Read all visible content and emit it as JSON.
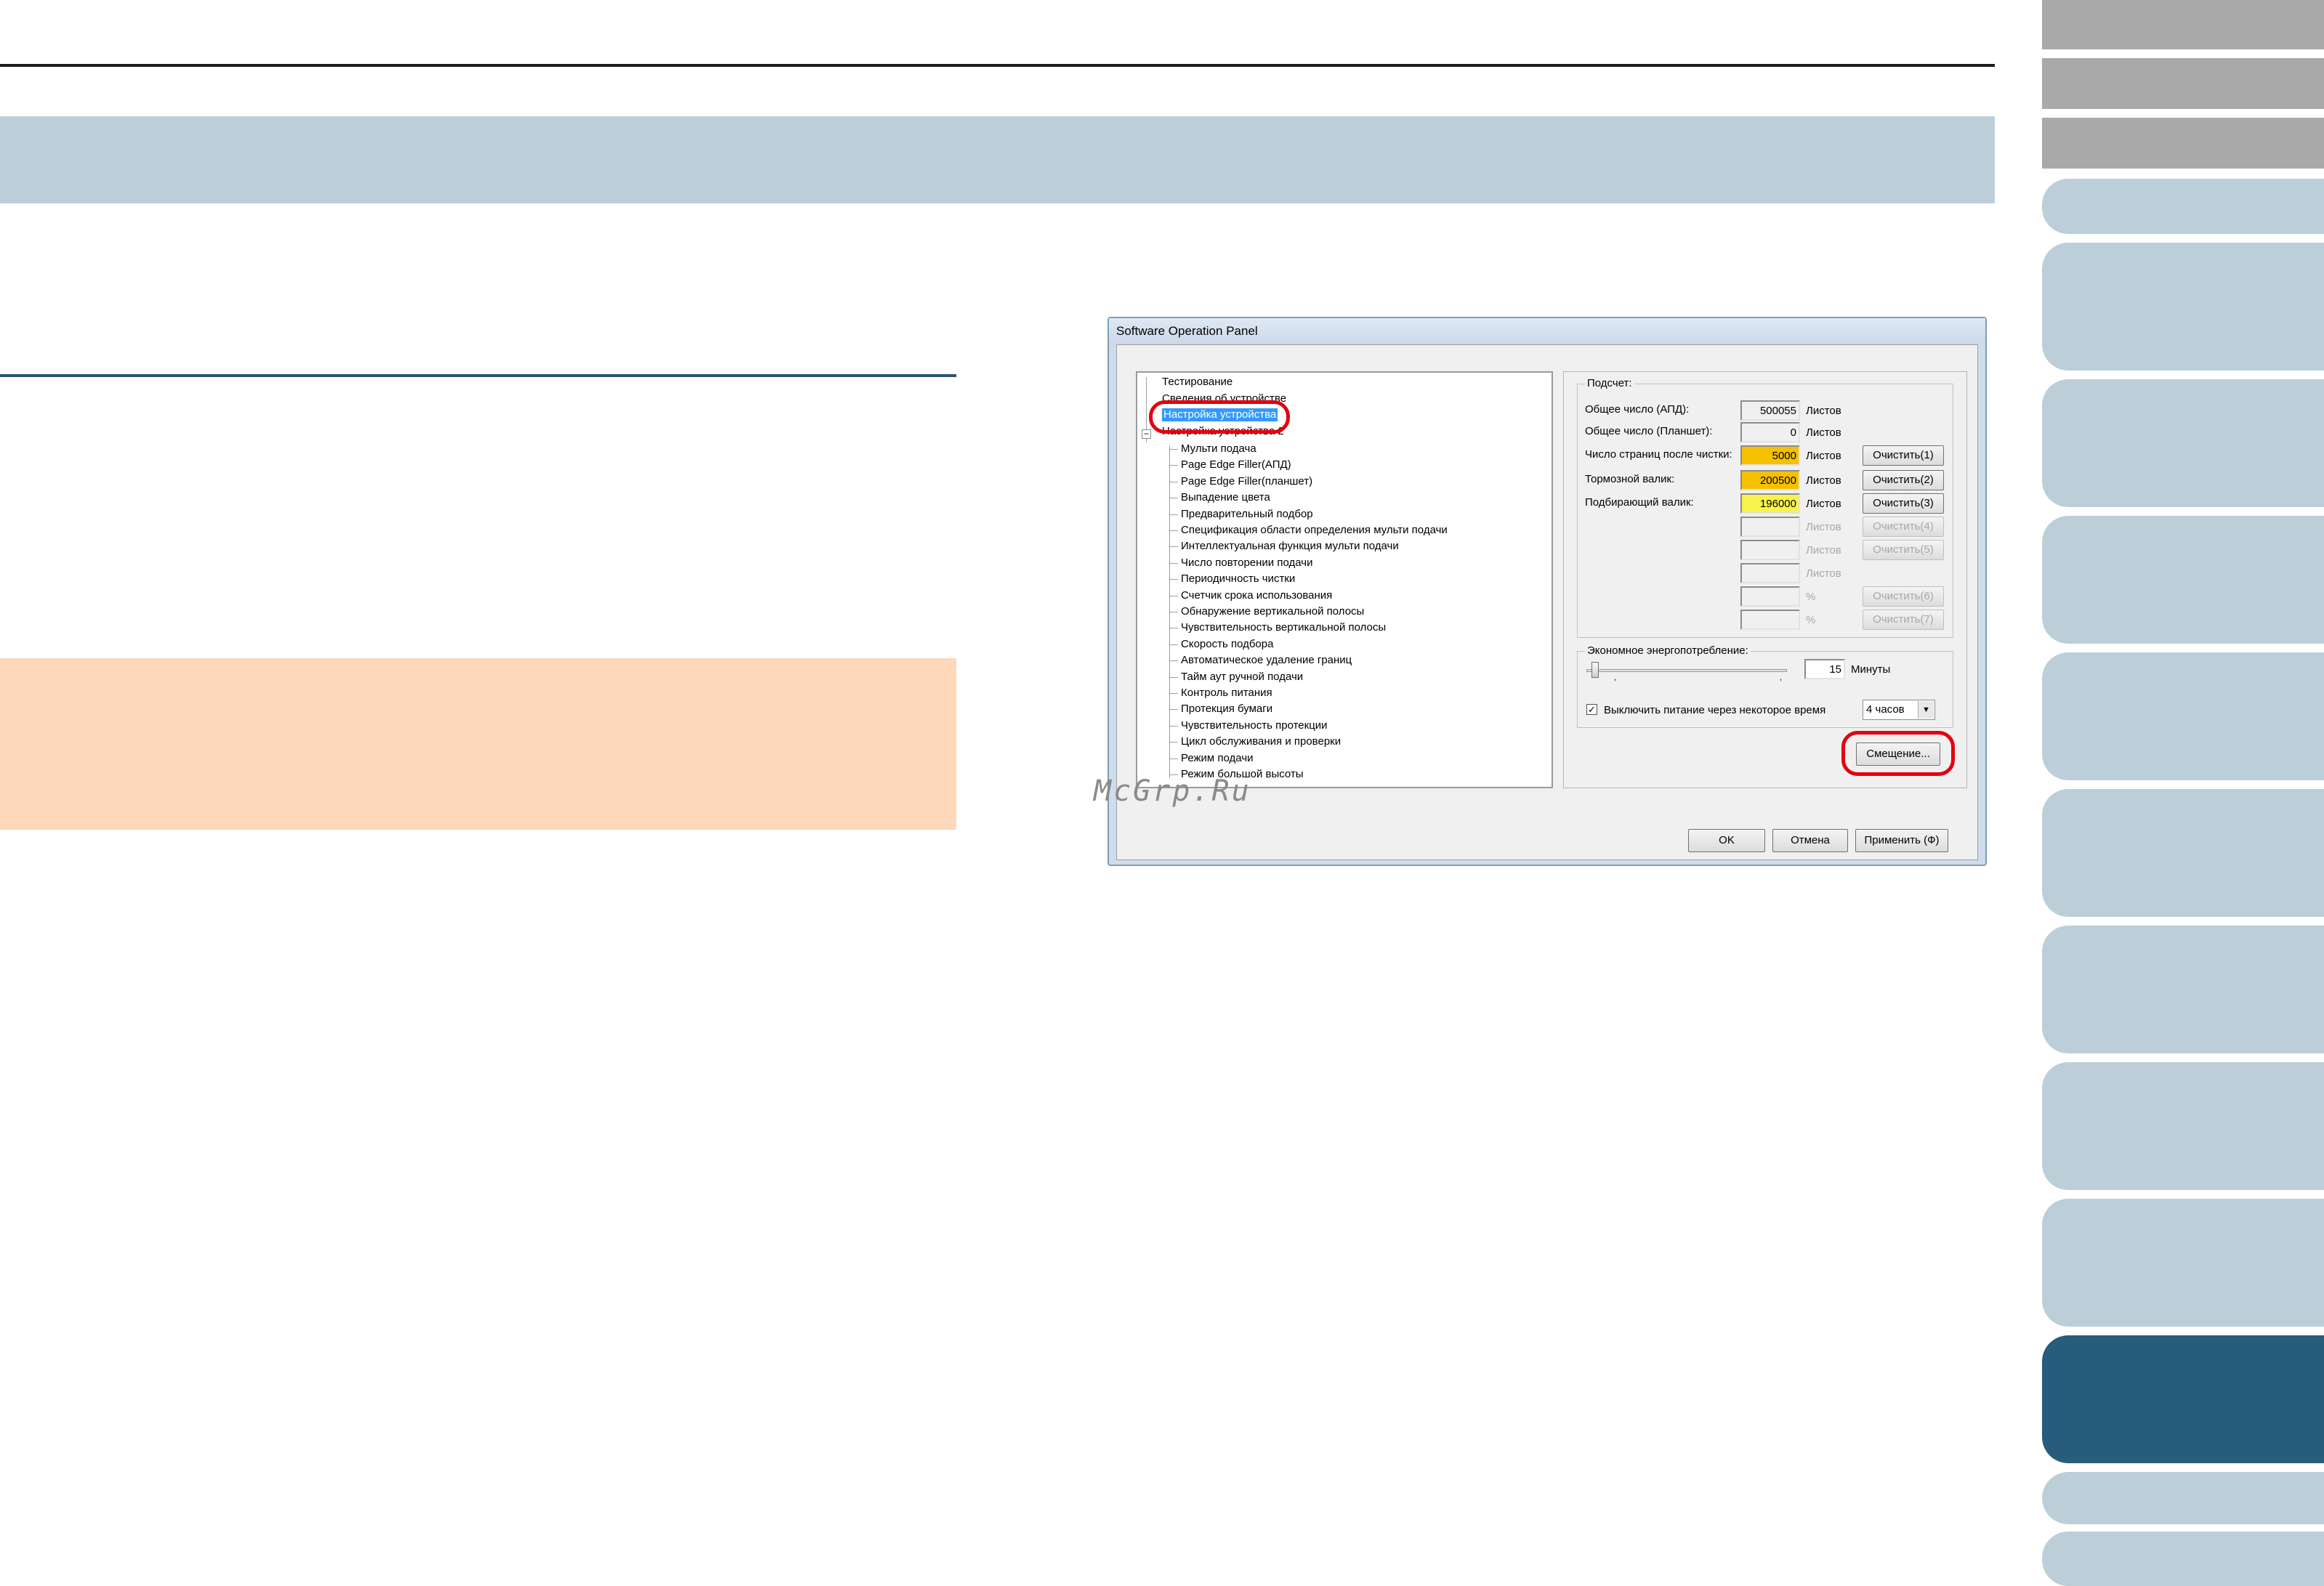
{
  "dialog": {
    "title": "Software Operation Panel",
    "tree": {
      "root_items": [
        "Тестирование",
        "Сведения об устройстве",
        "Настройка устройства",
        "Настройка устройства 2"
      ],
      "children": [
        "Мульти подача",
        "Page Edge Filler(АПД)",
        "Page Edge Filler(планшет)",
        "Выпадение цвета",
        "Предварительный подбор",
        "Спецификация области определения мульти подачи",
        "Интеллектуальная функция мульти подачи",
        "Число повторении подачи",
        "Периодичность чистки",
        "Счетчик срока использования",
        "Обнаружение вертикальной полосы",
        "Чувствительность вертикальной полосы",
        "Скорость подбора",
        "Автоматическое удаление границ",
        "Тайм аут ручной подачи",
        "Контроль питания",
        "Протекция бумаги",
        "Чувствительность протекции",
        "Цикл обслуживания и проверки",
        "Режим подачи",
        "Режим большой высоты"
      ]
    },
    "counter": {
      "group_title": "Подсчет:",
      "rows": [
        {
          "label": "Общее число (АПД):",
          "value": "500055",
          "unit": "Листов",
          "button": ""
        },
        {
          "label": "Общее число (Планшет):",
          "value": "0",
          "unit": "Листов",
          "button": ""
        },
        {
          "label": "Число страниц после чистки:",
          "value": "5000",
          "unit": "Листов",
          "button": "Очистить(1)"
        },
        {
          "label": "Тормозной валик:",
          "value": "200500",
          "unit": "Листов",
          "button": "Очистить(2)"
        },
        {
          "label": "Подбирающий валик:",
          "value": "196000",
          "unit": "Листов",
          "button": "Очистить(3)"
        },
        {
          "label": "",
          "value": "",
          "unit": "Листов",
          "button": "Очистить(4)"
        },
        {
          "label": "",
          "value": "",
          "unit": "Листов",
          "button": "Очистить(5)"
        },
        {
          "label": "",
          "value": "",
          "unit": "Листов",
          "button": ""
        },
        {
          "label": "",
          "value": "",
          "unit": "%",
          "button": "Очистить(6)"
        },
        {
          "label": "",
          "value": "",
          "unit": "%",
          "button": "Очистить(7)"
        }
      ]
    },
    "power": {
      "group_title": "Экономное энергопотребление:",
      "slider_value": 15,
      "value_text": "15",
      "unit": "Минуты",
      "auto_off_checked": true,
      "auto_off_label": "Выключить питание через некоторое время",
      "auto_off_option": "4 часов",
      "offset_button": "Смещение..."
    },
    "buttons": {
      "ok": "OK",
      "cancel": "Отмена",
      "apply": "Применить (Ф)"
    }
  },
  "watermark": "McGrp.Ru",
  "colors": {
    "header_band": "#bccfd9",
    "note_box": "#fdd8bb",
    "tab_active": "#275c7b",
    "highlight_ring": "#e3000f"
  }
}
